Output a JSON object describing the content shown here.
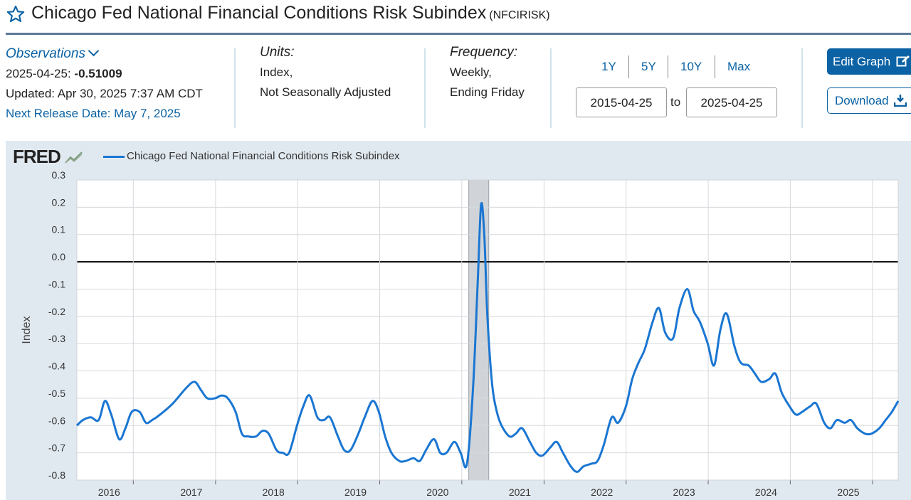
{
  "header": {
    "title": "Chicago Fed National Financial Conditions Risk Subindex",
    "series_code": "(NFCIRISK)"
  },
  "observations": {
    "label": "Observations",
    "date": "2025-04-25:",
    "value": "-0.51009",
    "updated": "Updated: Apr 30, 2025 7:37 AM CDT",
    "next_release": "Next Release Date: May 7, 2025"
  },
  "units": {
    "label": "Units:",
    "line1": "Index,",
    "line2": "Not Seasonally Adjusted"
  },
  "frequency": {
    "label": "Frequency:",
    "line1": "Weekly,",
    "line2": "Ending Friday"
  },
  "range": {
    "buttons": [
      "1Y",
      "5Y",
      "10Y",
      "Max"
    ],
    "start": "2015-04-25",
    "to": "to",
    "end": "2025-04-25"
  },
  "actions": {
    "edit_label": "Edit Graph",
    "download_label": "Download"
  },
  "logo": "FRED",
  "colors": {
    "accent": "#0b62a4",
    "series": "#1a76d2",
    "recession": "#d0d4d8"
  },
  "chart_data": {
    "type": "line",
    "legend": [
      "Chicago Fed National Financial Conditions Risk Subindex"
    ],
    "ylabel": "Index",
    "xlabel": "",
    "ylim": [
      -0.8,
      0.3
    ],
    "xlim": [
      "2015-04-25",
      "2025-04-25"
    ],
    "grid": true,
    "y_ticks": [
      "0.3",
      "0.2",
      "0.1",
      "0.0",
      "-0.1",
      "-0.2",
      "-0.3",
      "-0.4",
      "-0.5",
      "-0.6",
      "-0.7",
      "-0.8"
    ],
    "x_ticks": [
      "2016",
      "2017",
      "2018",
      "2019",
      "2020",
      "2021",
      "2022",
      "2023",
      "2024",
      "2025"
    ],
    "recession": {
      "start": "2020-02-01",
      "end": "2020-04-30"
    },
    "series": [
      {
        "name": "Chicago Fed National Financial Conditions Risk Subindex",
        "points": [
          [
            "2015-04-25",
            -0.6
          ],
          [
            "2015-05-22",
            -0.58
          ],
          [
            "2015-06-26",
            -0.57
          ],
          [
            "2015-07-31",
            -0.58
          ],
          [
            "2015-08-28",
            -0.51
          ],
          [
            "2015-09-25",
            -0.56
          ],
          [
            "2015-10-30",
            -0.65
          ],
          [
            "2015-11-27",
            -0.61
          ],
          [
            "2015-12-25",
            -0.55
          ],
          [
            "2016-01-29",
            -0.55
          ],
          [
            "2016-02-26",
            -0.59
          ],
          [
            "2016-03-25",
            -0.58
          ],
          [
            "2016-04-29",
            -0.56
          ],
          [
            "2016-06-24",
            -0.52
          ],
          [
            "2016-08-26",
            -0.46
          ],
          [
            "2016-09-30",
            -0.44
          ],
          [
            "2016-10-28",
            -0.47
          ],
          [
            "2016-11-25",
            -0.5
          ],
          [
            "2016-12-30",
            -0.5
          ],
          [
            "2017-01-27",
            -0.49
          ],
          [
            "2017-02-24",
            -0.5
          ],
          [
            "2017-03-31",
            -0.55
          ],
          [
            "2017-04-28",
            -0.63
          ],
          [
            "2017-05-26",
            -0.64
          ],
          [
            "2017-06-30",
            -0.64
          ],
          [
            "2017-07-28",
            -0.62
          ],
          [
            "2017-08-25",
            -0.63
          ],
          [
            "2017-09-29",
            -0.69
          ],
          [
            "2017-10-27",
            -0.7
          ],
          [
            "2017-11-24",
            -0.7
          ],
          [
            "2017-12-29",
            -0.6
          ],
          [
            "2018-01-26",
            -0.53
          ],
          [
            "2018-02-23",
            -0.49
          ],
          [
            "2018-03-30",
            -0.57
          ],
          [
            "2018-04-27",
            -0.58
          ],
          [
            "2018-05-25",
            -0.57
          ],
          [
            "2018-06-29",
            -0.64
          ],
          [
            "2018-07-27",
            -0.69
          ],
          [
            "2018-08-24",
            -0.69
          ],
          [
            "2018-09-28",
            -0.63
          ],
          [
            "2018-10-26",
            -0.57
          ],
          [
            "2018-11-30",
            -0.51
          ],
          [
            "2018-12-28",
            -0.55
          ],
          [
            "2019-01-25",
            -0.64
          ],
          [
            "2019-02-22",
            -0.7
          ],
          [
            "2019-03-29",
            -0.73
          ],
          [
            "2019-04-26",
            -0.73
          ],
          [
            "2019-05-31",
            -0.72
          ],
          [
            "2019-06-28",
            -0.73
          ],
          [
            "2019-07-26",
            -0.69
          ],
          [
            "2019-08-30",
            -0.65
          ],
          [
            "2019-09-27",
            -0.7
          ],
          [
            "2019-10-25",
            -0.7
          ],
          [
            "2019-11-29",
            -0.66
          ],
          [
            "2019-12-27",
            -0.7
          ],
          [
            "2020-01-24",
            -0.74
          ],
          [
            "2020-02-21",
            -0.45
          ],
          [
            "2020-03-13",
            -0.05
          ],
          [
            "2020-03-27",
            0.21
          ],
          [
            "2020-04-10",
            0.1
          ],
          [
            "2020-04-24",
            -0.2
          ],
          [
            "2020-05-15",
            -0.45
          ],
          [
            "2020-06-05",
            -0.55
          ],
          [
            "2020-06-26",
            -0.6
          ],
          [
            "2020-07-31",
            -0.64
          ],
          [
            "2020-08-28",
            -0.63
          ],
          [
            "2020-09-25",
            -0.61
          ],
          [
            "2020-10-30",
            -0.66
          ],
          [
            "2020-11-27",
            -0.7
          ],
          [
            "2020-12-25",
            -0.71
          ],
          [
            "2021-01-29",
            -0.68
          ],
          [
            "2021-02-26",
            -0.66
          ],
          [
            "2021-03-26",
            -0.7
          ],
          [
            "2021-04-30",
            -0.75
          ],
          [
            "2021-05-28",
            -0.77
          ],
          [
            "2021-06-25",
            -0.75
          ],
          [
            "2021-07-30",
            -0.74
          ],
          [
            "2021-08-27",
            -0.73
          ],
          [
            "2021-09-24",
            -0.67
          ],
          [
            "2021-10-29",
            -0.57
          ],
          [
            "2021-11-26",
            -0.59
          ],
          [
            "2021-12-31",
            -0.53
          ],
          [
            "2022-01-28",
            -0.43
          ],
          [
            "2022-02-25",
            -0.37
          ],
          [
            "2022-03-25",
            -0.32
          ],
          [
            "2022-04-29",
            -0.22
          ],
          [
            "2022-05-27",
            -0.17
          ],
          [
            "2022-06-24",
            -0.26
          ],
          [
            "2022-07-29",
            -0.28
          ],
          [
            "2022-08-26",
            -0.17
          ],
          [
            "2022-09-30",
            -0.1
          ],
          [
            "2022-10-28",
            -0.18
          ],
          [
            "2022-11-25",
            -0.22
          ],
          [
            "2022-12-30",
            -0.3
          ],
          [
            "2023-01-27",
            -0.38
          ],
          [
            "2023-02-24",
            -0.25
          ],
          [
            "2023-03-24",
            -0.19
          ],
          [
            "2023-04-28",
            -0.31
          ],
          [
            "2023-05-26",
            -0.37
          ],
          [
            "2023-06-30",
            -0.38
          ],
          [
            "2023-07-28",
            -0.41
          ],
          [
            "2023-08-25",
            -0.44
          ],
          [
            "2023-09-29",
            -0.43
          ],
          [
            "2023-10-27",
            -0.41
          ],
          [
            "2023-11-24",
            -0.48
          ],
          [
            "2023-12-29",
            -0.53
          ],
          [
            "2024-01-26",
            -0.56
          ],
          [
            "2024-02-23",
            -0.55
          ],
          [
            "2024-03-29",
            -0.53
          ],
          [
            "2024-04-26",
            -0.52
          ],
          [
            "2024-05-31",
            -0.59
          ],
          [
            "2024-06-28",
            -0.61
          ],
          [
            "2024-07-26",
            -0.58
          ],
          [
            "2024-08-30",
            -0.59
          ],
          [
            "2024-09-27",
            -0.58
          ],
          [
            "2024-10-25",
            -0.61
          ],
          [
            "2024-11-29",
            -0.63
          ],
          [
            "2024-12-27",
            -0.63
          ],
          [
            "2025-01-31",
            -0.61
          ],
          [
            "2025-02-28",
            -0.58
          ],
          [
            "2025-03-28",
            -0.55
          ],
          [
            "2025-04-25",
            -0.51
          ]
        ]
      }
    ]
  }
}
